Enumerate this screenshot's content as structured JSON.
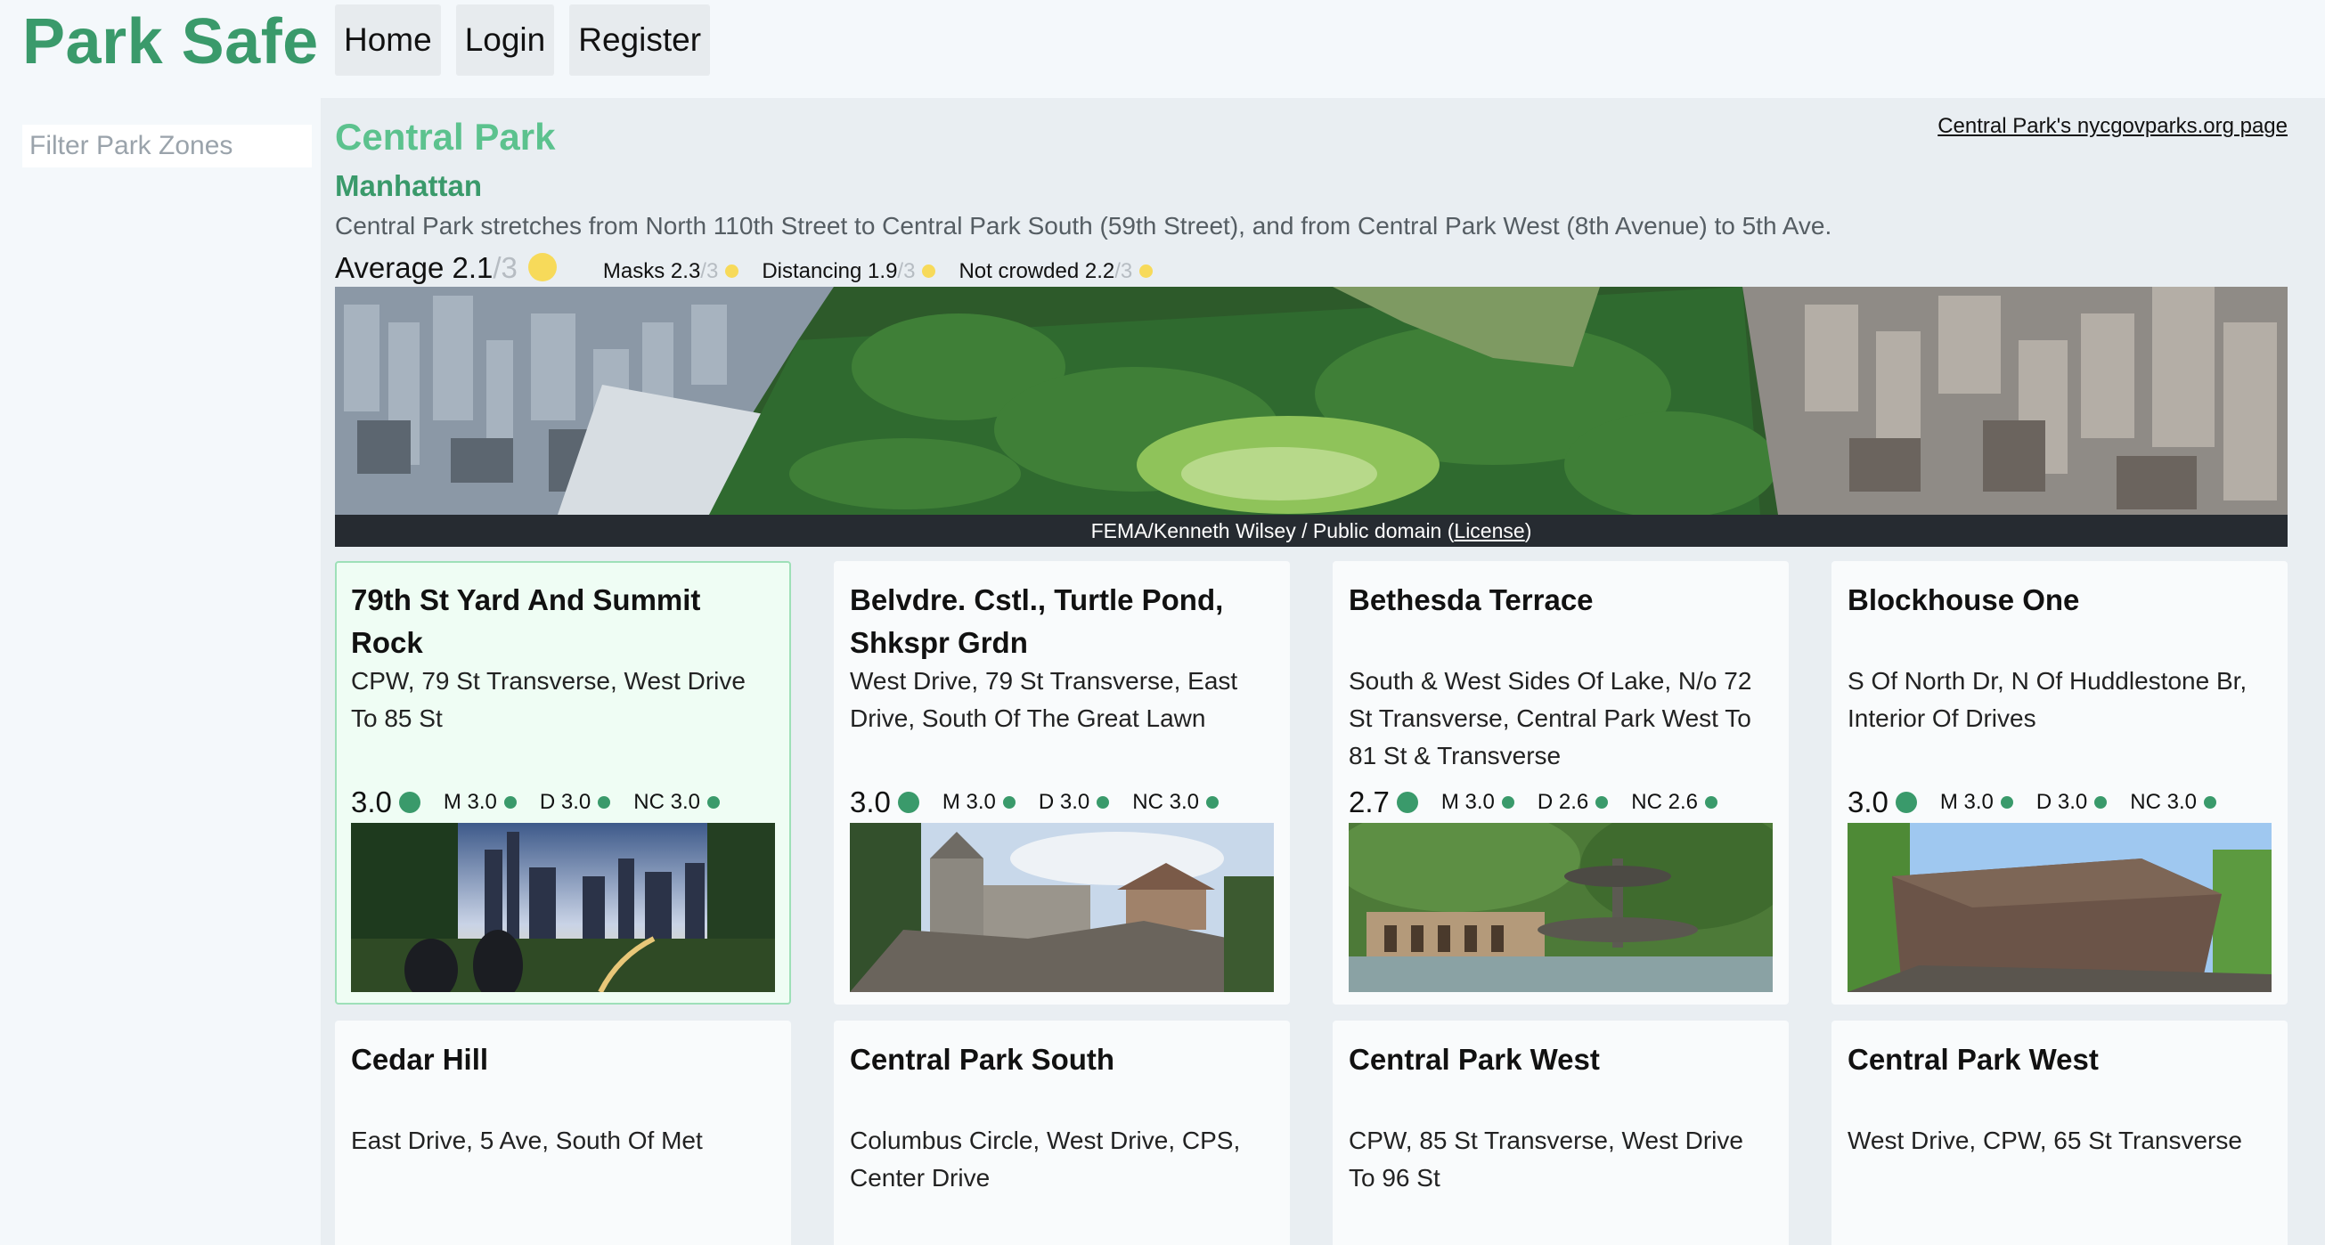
{
  "header": {
    "logo": "Park Safe",
    "nav": [
      "Home",
      "Login",
      "Register"
    ]
  },
  "filter": {
    "placeholder": "Filter Park Zones",
    "value": ""
  },
  "park": {
    "name": "Central Park",
    "link_text": "Central Park's nycgovparks.org page",
    "borough": "Manhattan",
    "description": "Central Park stretches from North 110th Street to Central Park South (59th Street), and from Central Park West (8th Avenue) to 5th Ave.",
    "average": {
      "label": "Average",
      "value": "2.1",
      "max": "/3"
    },
    "sub_ratings": [
      {
        "label": "Masks",
        "value": "2.3",
        "max": "/3"
      },
      {
        "label": "Distancing",
        "value": "1.9",
        "max": "/3"
      },
      {
        "label": "Not crowded",
        "value": "2.2",
        "max": "/3"
      }
    ],
    "credit": {
      "text": "FEMA/Kenneth Wilsey / Public domain (",
      "link": "License",
      "close": ")"
    },
    "rating_color": "#f7da5a"
  },
  "zones": [
    {
      "title": "79th St Yard And Summit Rock",
      "address": "CPW, 79 St Transverse, West Drive To 85 St",
      "score": "3.0",
      "m": "M 3.0",
      "d": "D 3.0",
      "nc": "NC 3.0",
      "image": "skyline-dusk"
    },
    {
      "title": "Belvdre. Cstl., Turtle Pond, Shkspr Grdn",
      "address": "West Drive, 79 St Transverse, East Drive, South Of The Great Lawn",
      "score": "3.0",
      "m": "M 3.0",
      "d": "D 3.0",
      "nc": "NC 3.0",
      "image": "castle"
    },
    {
      "title": "Bethesda Terrace",
      "address": "South & West Sides Of Lake, N/o 72 St Transverse, Central Park West To 81 St & Transverse",
      "score": "2.7",
      "m": "M 3.0",
      "d": "D 2.6",
      "nc": "NC 2.6",
      "image": "fountain"
    },
    {
      "title": "Blockhouse One",
      "address": "S Of North Dr, N Of Huddlestone Br, Interior Of Drives",
      "score": "3.0",
      "m": "M 3.0",
      "d": "D 3.0",
      "nc": "NC 3.0",
      "image": "stone-blockhouse"
    }
  ],
  "zones_row2": [
    {
      "title": "Cedar Hill",
      "address": "East Drive, 5 Ave, South Of Met"
    },
    {
      "title": "Central Park South",
      "address": "Columbus Circle, West Drive, CPS, Center Drive"
    },
    {
      "title": "Central Park West",
      "address": "CPW, 85 St Transverse, West Drive To 96 St"
    },
    {
      "title": "Central Park West",
      "address": "West Drive, CPW, 65 St Transverse"
    }
  ],
  "good_color": "#3a9a6b"
}
